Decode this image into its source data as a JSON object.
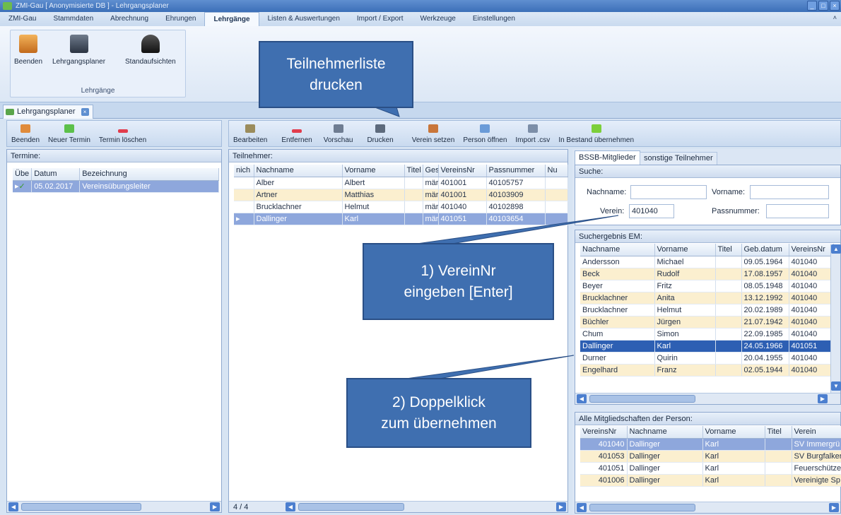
{
  "window": {
    "title": "ZMI-Gau  [ Anonymisierte DB ]  - Lehrgangsplaner"
  },
  "menu": [
    "ZMI-Gau",
    "Stammdaten",
    "Abrechnung",
    "Ehrungen",
    "Lehrgänge",
    "Listen & Auswertungen",
    "Import / Export",
    "Werkzeuge",
    "Einstellungen"
  ],
  "ribbon": {
    "buttons": [
      "Beenden",
      "Lehrgangsplaner",
      "Standaufsichten"
    ],
    "group_label": "Lehrgänge"
  },
  "doc_tab": "Lehrgangsplaner",
  "left_toolbar": [
    "Beenden",
    "Neuer Termin",
    "Termin löschen"
  ],
  "mid_toolbar": [
    "Bearbeiten",
    "Entfernen",
    "Vorschau",
    "Drucken",
    "Verein setzen",
    "Person öffnen",
    "Import .csv",
    "In Bestand übernehmen"
  ],
  "termine": {
    "header": "Termine:",
    "columns": [
      "Übe",
      "Datum",
      "Bezeichnung"
    ],
    "rows": [
      [
        "05.02.2017",
        "Vereinsübungsleiter"
      ]
    ]
  },
  "teilnehmer": {
    "header": "Teilnehmer:",
    "columns": [
      "nich",
      "Nachname",
      "Vorname",
      "Titel",
      "Ges",
      "VereinsNr",
      "Passnummer",
      "Nu"
    ],
    "rows": [
      [
        "Alber",
        "Albert",
        "mär",
        "401001",
        "40105757"
      ],
      [
        "Artner",
        "Matthias",
        "mär",
        "401001",
        "40103909"
      ],
      [
        "Brucklachner",
        "Helmut",
        "mär",
        "401040",
        "40102898"
      ],
      [
        "Dallinger",
        "Karl",
        "mär",
        "401051",
        "40103654"
      ]
    ],
    "footer": "4 / 4"
  },
  "right_tabs": [
    "BSSB-Mitglieder",
    "sonstige Teilnehmer"
  ],
  "suche": {
    "header": "Suche:",
    "nachname_label": "Nachname:",
    "vorname_label": "Vorname:",
    "verein_label": "Verein:",
    "verein_value": "401040",
    "passnummer_label": "Passnummer:"
  },
  "ergebnis": {
    "header": "Suchergebnis EM:",
    "columns": [
      "Nachname",
      "Vorname",
      "Titel",
      "Geb.datum",
      "VereinsNr"
    ],
    "rows": [
      [
        "Andersson",
        "Michael",
        "09.05.1964",
        "401040"
      ],
      [
        "Beck",
        "Rudolf",
        "17.08.1957",
        "401040"
      ],
      [
        "Beyer",
        "Fritz",
        "08.05.1948",
        "401040"
      ],
      [
        "Brucklachner",
        "Anita",
        "13.12.1992",
        "401040"
      ],
      [
        "Brucklachner",
        "Helmut",
        "20.02.1989",
        "401040"
      ],
      [
        "Büchler",
        "Jürgen",
        "21.07.1942",
        "401040"
      ],
      [
        "Chum",
        "Simon",
        "22.09.1985",
        "401040"
      ],
      [
        "Dallinger",
        "Karl",
        "24.05.1966",
        "401051"
      ],
      [
        "Durner",
        "Quirin",
        "20.04.1955",
        "401040"
      ],
      [
        "Engelhard",
        "Franz",
        "02.05.1944",
        "401040"
      ]
    ]
  },
  "mitgliedschaften": {
    "header": "Alle Mitgliedschaften der Person:",
    "columns": [
      "VereinsNr",
      "Nachname",
      "Vorname",
      "Titel",
      "Verein"
    ],
    "rows": [
      [
        "401040",
        "Dallinger",
        "Karl",
        "SV Immergrü"
      ],
      [
        "401053",
        "Dallinger",
        "Karl",
        "SV Burgfalker"
      ],
      [
        "401051",
        "Dallinger",
        "Karl",
        "Feuerschütze"
      ],
      [
        "401006",
        "Dallinger",
        "Karl",
        "Vereinigte Sp"
      ]
    ]
  },
  "callouts": {
    "print": [
      "Teilnehmerliste",
      "drucken"
    ],
    "step1": [
      "1) VereinNr",
      "eingeben [Enter]"
    ],
    "step2": [
      "2) Doppelklick",
      "zum übernehmen"
    ]
  }
}
